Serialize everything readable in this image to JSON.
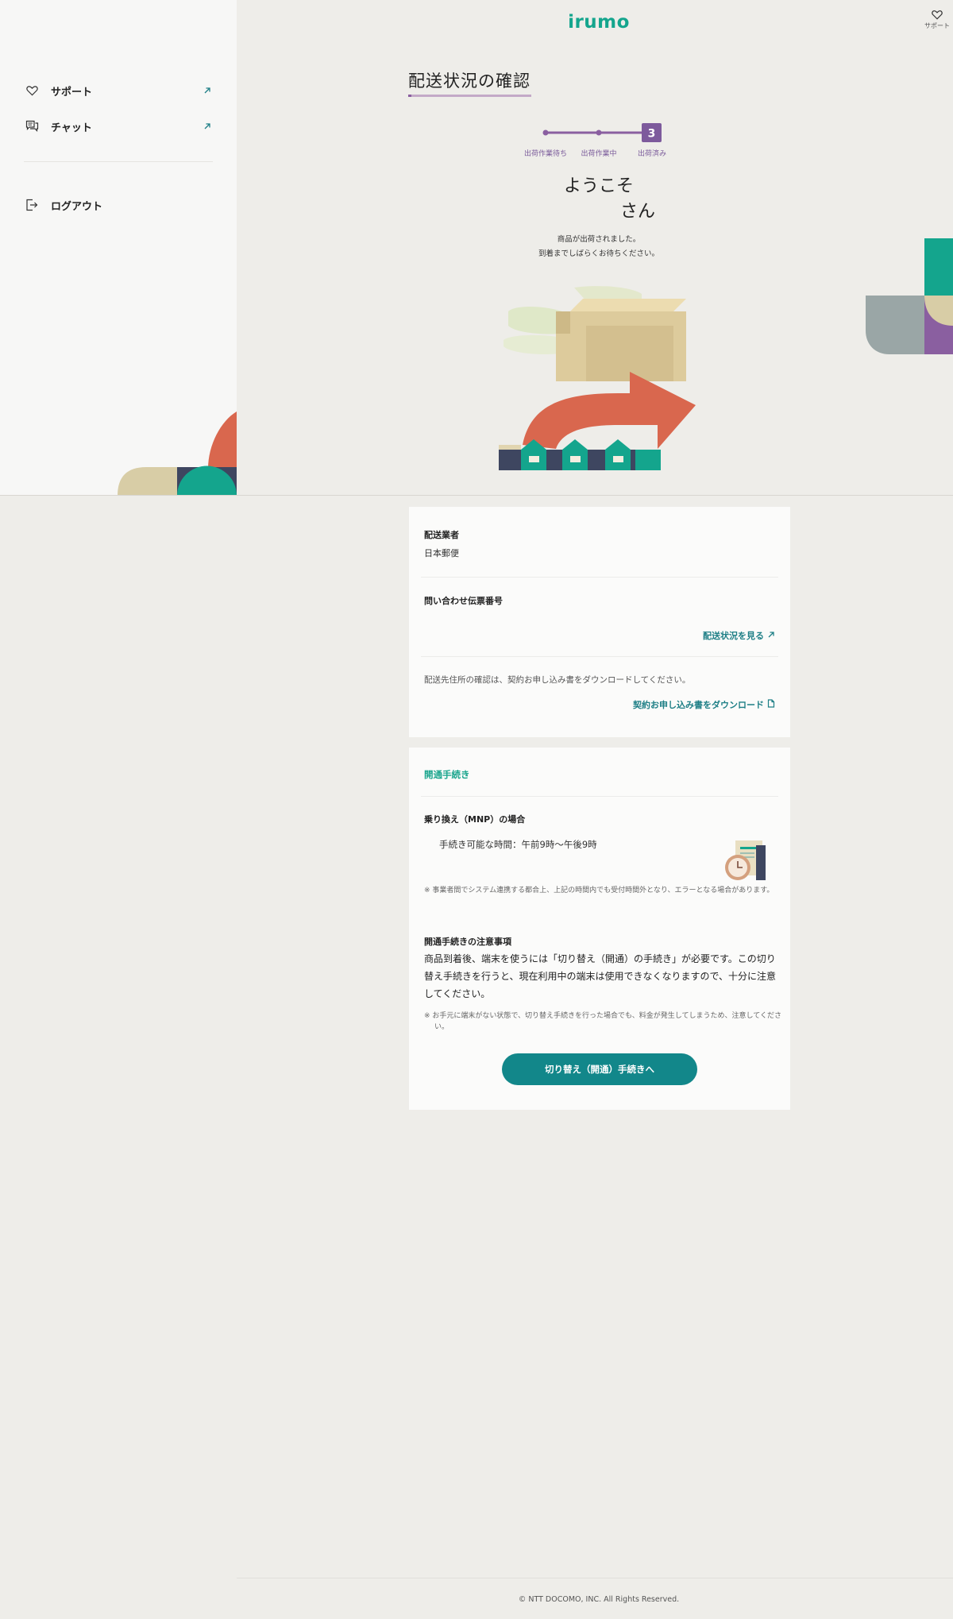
{
  "brand": {
    "logo_text": "irumo",
    "accent": "#12A58D"
  },
  "header": {
    "support_label": "サポート"
  },
  "sidebar": {
    "items": [
      {
        "label": "サポート",
        "icon": "heart-icon",
        "external": true
      },
      {
        "label": "チャット",
        "icon": "chat-icon",
        "external": true
      },
      {
        "label": "ログアウト",
        "icon": "logout-icon",
        "external": false
      }
    ]
  },
  "page": {
    "title": "配送状況の確認",
    "steps": {
      "items": [
        {
          "label": "出荷作業待ち"
        },
        {
          "label": "出荷作業中"
        },
        {
          "label": "出荷済み",
          "number": "3",
          "active": true
        }
      ]
    },
    "welcome_line1": "ようこそ",
    "welcome_line2": "さん",
    "message_line1": "商品が出荷されました。",
    "message_line2": "到着までしばらくお待ちください。"
  },
  "shipping_card": {
    "carrier_label": "配送業者",
    "carrier_value": "日本郵便",
    "tracking_label": "問い合わせ伝票番号",
    "tracking_value": "",
    "tracking_link": "配送状況を見る",
    "address_note": "配送先住所の確認は、契約お申し込み書をダウンロードしてください。",
    "download_link": "契約お申し込み書をダウンロード"
  },
  "activation_card": {
    "section_title": "開通手続き",
    "mnp_title": "乗り換え（MNP）の場合",
    "available_time": "手続き可能な時間：午前9時〜午後9時",
    "mnp_note": "※ 事業者間でシステム連携する都合上、上記の時間内でも受付時間外となり、エラーとなる場合があります。",
    "caution_title": "開通手続きの注意事項",
    "caution_body": "商品到着後、端末を使うには「切り替え（開通）の手続き」が必要です。この切り替え手続きを行うと、現在利用中の端末は使用できなくなりますので、十分に注意してください。",
    "caution_note": "※ お手元に端末がない状態で、切り替え手続きを行った場合でも、料金が発生してしまうため、注意してください。",
    "cta_label": "切り替え（開通）手続きへ"
  },
  "footer": {
    "copyright": "© NTT DOCOMO, INC. All Rights Reserved."
  }
}
